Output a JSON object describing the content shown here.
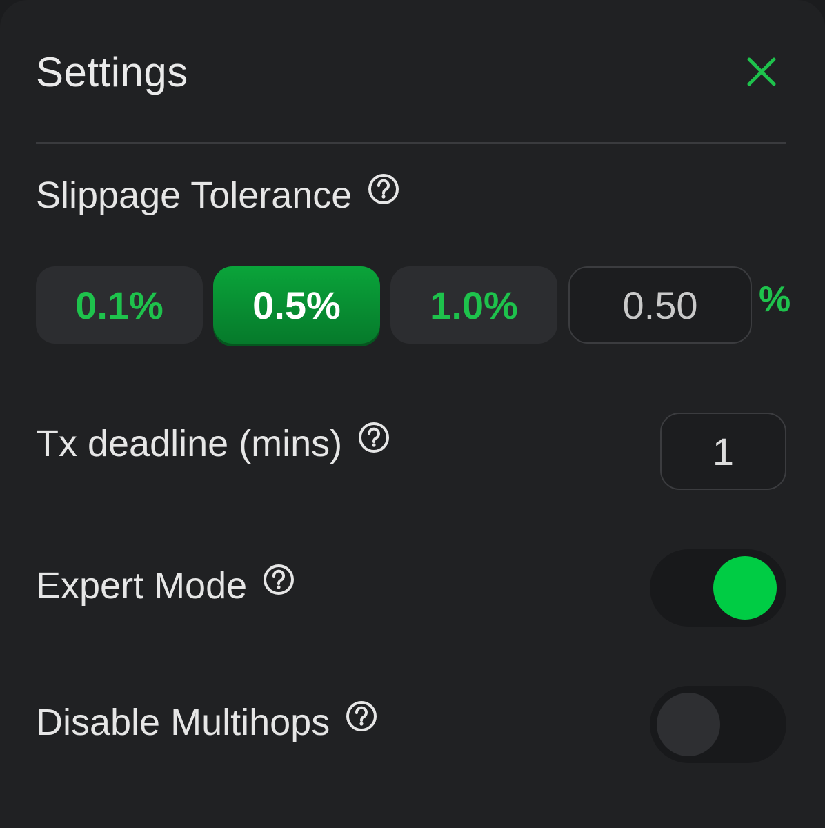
{
  "header": {
    "title": "Settings",
    "close_icon": "close-icon",
    "accent_color": "#1ec24c"
  },
  "slippage": {
    "label": "Slippage Tolerance",
    "presets": [
      {
        "label": "0.1%",
        "selected": false
      },
      {
        "label": "0.5%",
        "selected": true
      },
      {
        "label": "1.0%",
        "selected": false
      }
    ],
    "custom_value": "0.50",
    "unit": "%"
  },
  "deadline": {
    "label": "Tx deadline (mins)",
    "value": "1"
  },
  "expert_mode": {
    "label": "Expert Mode",
    "enabled": true
  },
  "multihops": {
    "label": "Disable Multihops",
    "enabled": false
  }
}
